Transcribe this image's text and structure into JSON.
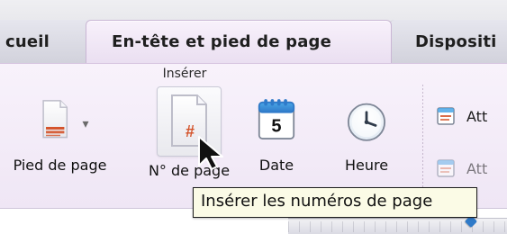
{
  "tabs": {
    "left_label": "cueil",
    "active_label": "En-tête et pied de page",
    "right_label": "Dispositi"
  },
  "ribbon": {
    "section_title": "Insérer",
    "controls": {
      "footer_label": "Pied de page",
      "page_number_label": "N° de page",
      "date_label": "Date",
      "time_label": "Heure"
    },
    "calendar_day": "5",
    "right_items": [
      {
        "label": "Att",
        "icon": "attach-icon"
      },
      {
        "label": "Att",
        "icon": "attach-icon"
      }
    ]
  },
  "tooltip": {
    "text": "Insérer les numéros de page"
  },
  "colors": {
    "accent_purple": "#C9B6D4",
    "tooltip_bg": "#FBFBE6",
    "marker_blue": "#2F7AC9",
    "page_number_hash": "#D4532A"
  }
}
